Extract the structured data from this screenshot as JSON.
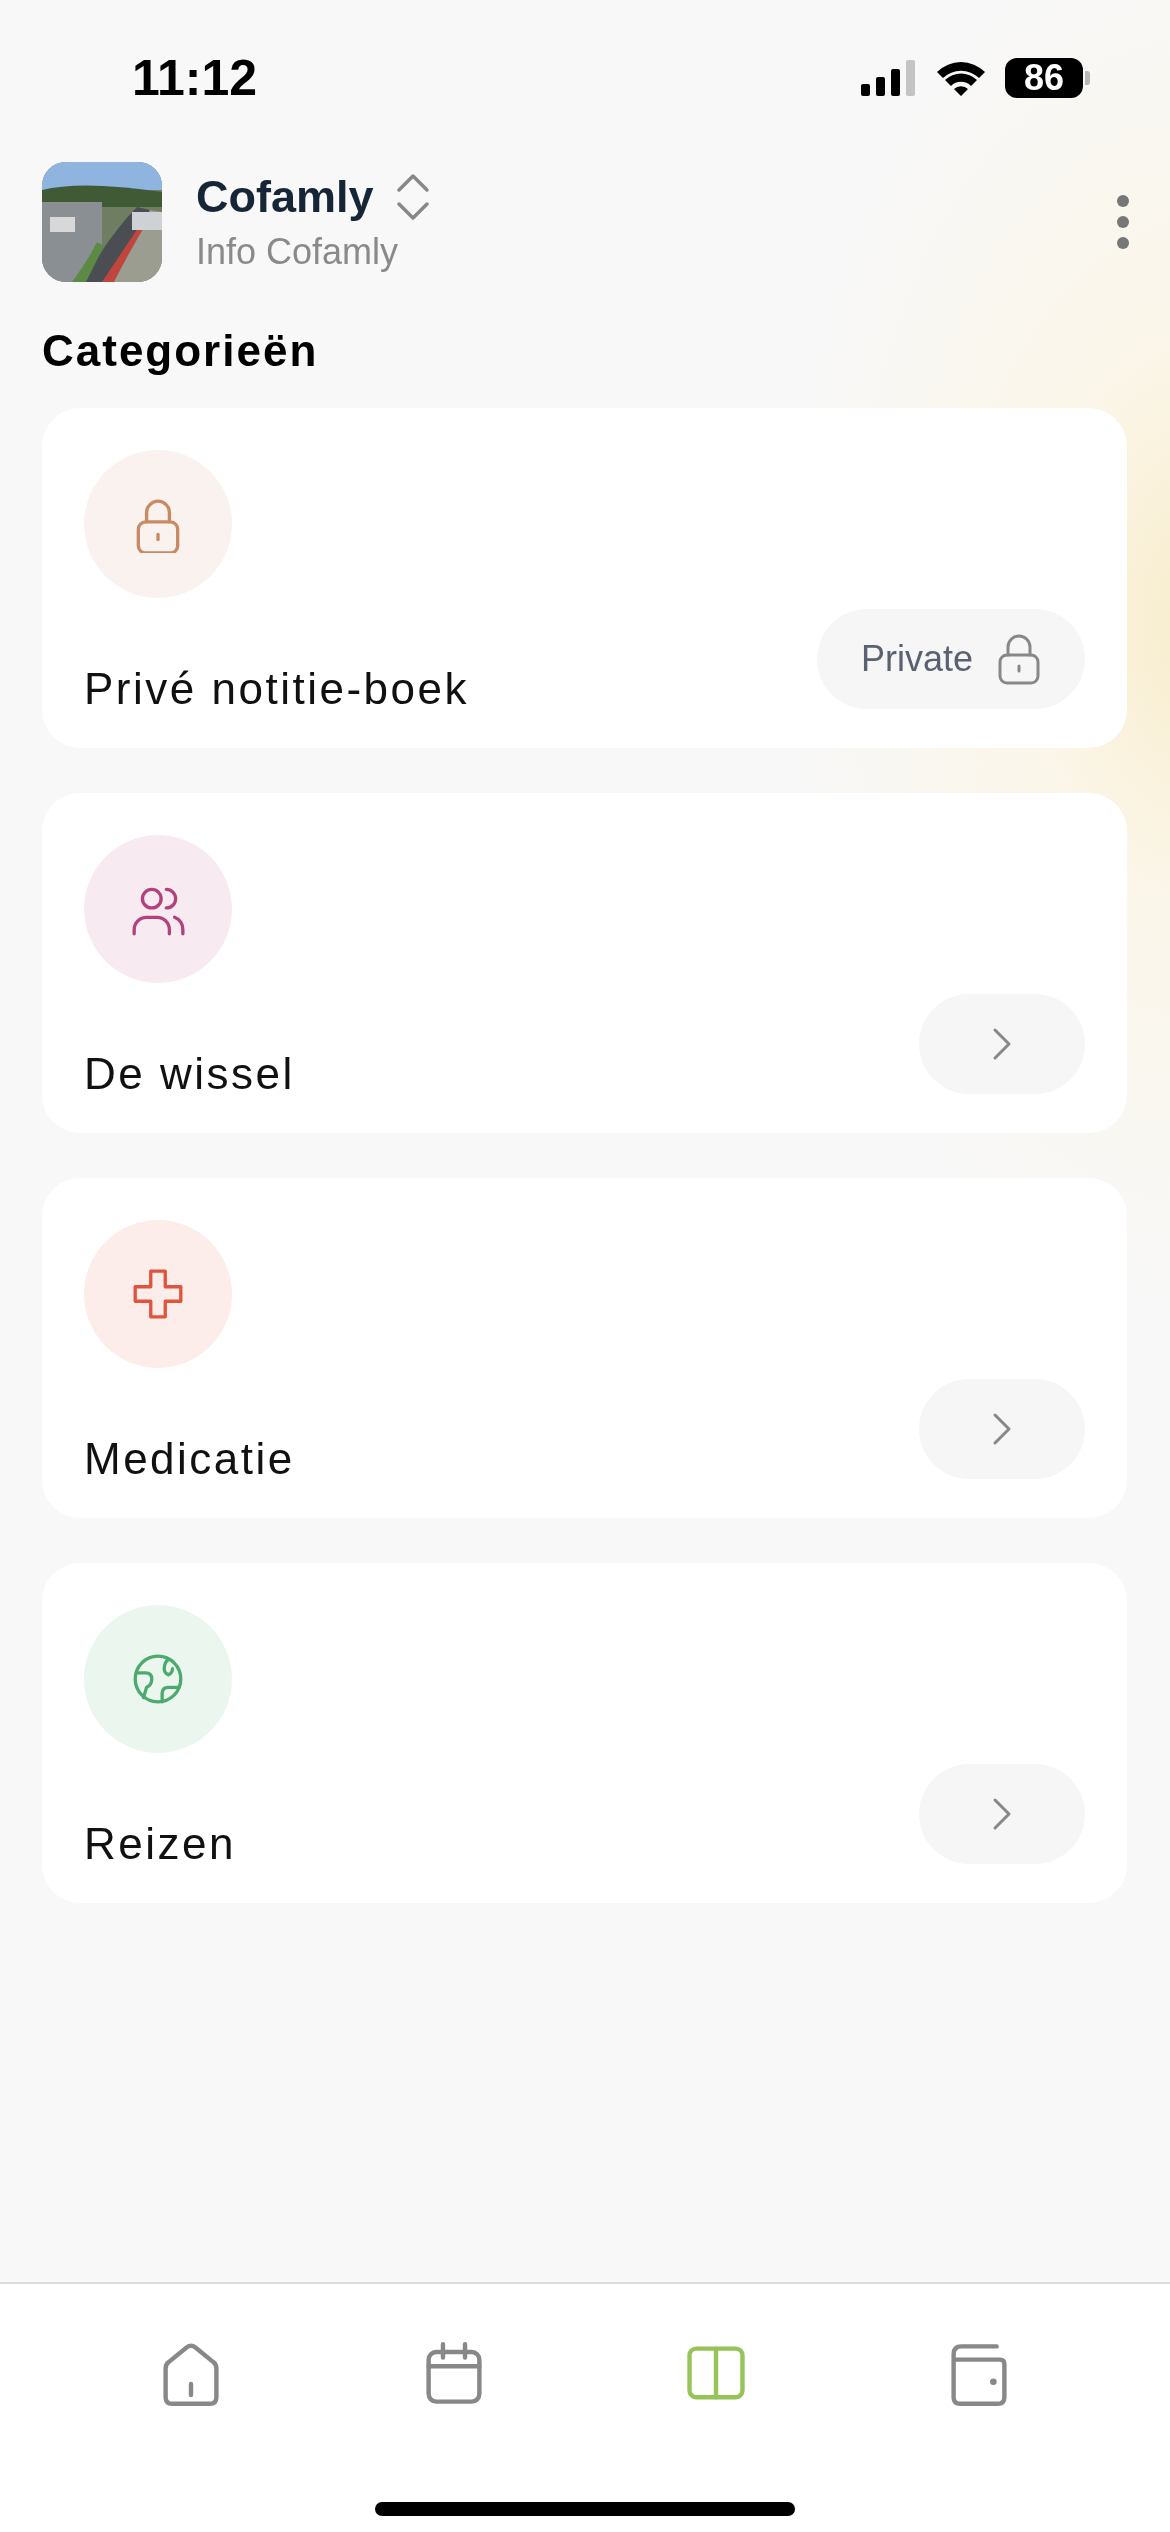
{
  "status_bar": {
    "time": "11:12",
    "battery": "86"
  },
  "header": {
    "title": "Cofamly",
    "subtitle": "Info Cofamly"
  },
  "section_title": "Categorieën",
  "categories": [
    {
      "title": "Privé notitie-boek",
      "color": "#c98a63",
      "kind": "private",
      "badge": "Private"
    },
    {
      "title": "De wissel",
      "color": "#b2417c",
      "kind": "link"
    },
    {
      "title": "Medicatie",
      "color": "#e0533d",
      "kind": "link"
    },
    {
      "title": "Reizen",
      "color": "#4caa6e",
      "kind": "link"
    }
  ],
  "tab_bar": [
    {
      "selected": false
    },
    {
      "selected": false
    },
    {
      "selected": true
    },
    {
      "selected": false
    }
  ]
}
